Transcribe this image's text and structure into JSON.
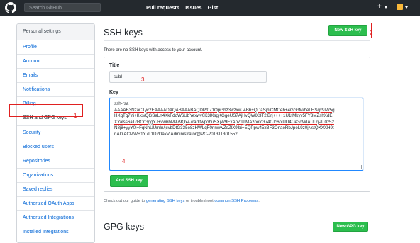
{
  "header": {
    "search_placeholder": "Search GitHub",
    "nav": [
      "Pull requests",
      "Issues",
      "Gist"
    ],
    "plus": "+",
    "accent": "#24292e"
  },
  "sidebar": {
    "heading": "Personal settings",
    "items": [
      {
        "label": "Profile"
      },
      {
        "label": "Account"
      },
      {
        "label": "Emails"
      },
      {
        "label": "Notifications"
      },
      {
        "label": "Billing"
      },
      {
        "label": "SSH and GPG keys",
        "selected": true
      },
      {
        "label": "Security"
      },
      {
        "label": "Blocked users"
      },
      {
        "label": "Repositories"
      },
      {
        "label": "Organizations"
      },
      {
        "label": "Saved replies"
      },
      {
        "label": "Authorized OAuth Apps"
      },
      {
        "label": "Authorized Integrations"
      },
      {
        "label": "Installed Integrations"
      }
    ]
  },
  "ssh": {
    "title": "SSH keys",
    "new_button": "New SSH key",
    "empty_text": "There are no SSH keys with access to your account.",
    "title_label": "Title",
    "title_value": "subl",
    "key_label": "Key",
    "key_lines": [
      "ssh-rsa",
      "AAAAB3NzaC1yc2EAAAADAQABAAABAQDP/071OpGhz3wzxwJ4B6+QDaSjhiCMCeh+4GcGM/beLHSqx9lW5g",
      "HXgTg7Yi+Kks/QGSaLn4KkFdoW6UbYexwv0K3lXsgKGgeUS7AjHvQWlX3T2lBrj++++1U1tMkyv5FY3MZshXdE",
      "XYalss6aTd8CrGggYJ+vw6bM979Qx47raditwpohuSXjW9ExApZlUjMAzoofc3740Jc6oiUU4tJe3oWIAULqPU0z52",
      "N8j8+yyY0i+FqNhUUmIn/jcvbDtG335e8zHWLqF0nnwwZeZlX9lbi+EQPpw45xBF3OnaeRbJpeL9z0jNstQXXXH9t",
      "nADiACMWB1Y7L1D2DakV Administrator@PC-201311301552"
    ],
    "add_button": "Add SSH key",
    "guide_pre": "Check out our guide to ",
    "guide_link1": "generating SSH keys",
    "guide_mid": " or troubleshoot ",
    "guide_link2": "common SSH Problems",
    "guide_post": "."
  },
  "gpg": {
    "title": "GPG keys",
    "new_button": "New GPG key"
  },
  "annotations": {
    "n1": "1",
    "n2": "2",
    "n3": "3",
    "n4": "4"
  }
}
